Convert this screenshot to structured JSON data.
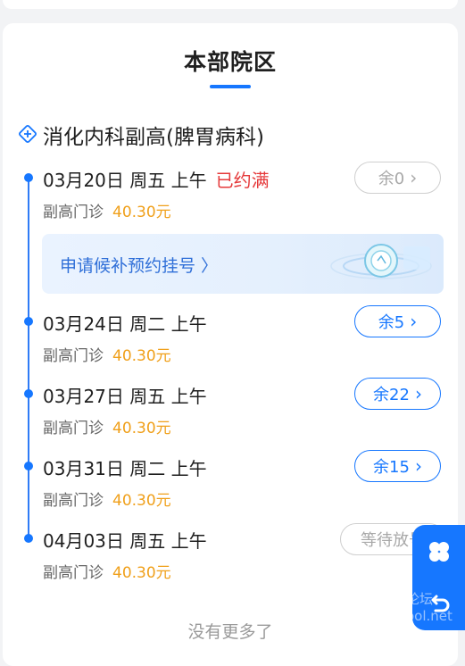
{
  "campus": {
    "title": "本部院区"
  },
  "department": {
    "name": "消化内科副高(脾胃病科)",
    "icon": "plus-diamond-icon"
  },
  "slots": [
    {
      "date": "03月20日",
      "weekday": "周五",
      "period": "上午",
      "status": "已约满",
      "type": "副高门诊",
      "price": "40.30元",
      "button": "余0",
      "available": false
    },
    {
      "date": "03月24日",
      "weekday": "周二",
      "period": "上午",
      "status": "",
      "type": "副高门诊",
      "price": "40.30元",
      "button": "余5",
      "available": true
    },
    {
      "date": "03月27日",
      "weekday": "周五",
      "period": "上午",
      "status": "",
      "type": "副高门诊",
      "price": "40.30元",
      "button": "余22",
      "available": true
    },
    {
      "date": "03月31日",
      "weekday": "周二",
      "period": "上午",
      "status": "",
      "type": "副高门诊",
      "price": "40.30元",
      "button": "余15",
      "available": true
    },
    {
      "date": "04月03日",
      "weekday": "周五",
      "period": "上午",
      "status": "",
      "type": "副高门诊",
      "price": "40.30元",
      "button": "等待放号",
      "available": false
    }
  ],
  "waitlist": {
    "label": "申请候补预约挂号 〉"
  },
  "footer": {
    "end_text": "没有更多了"
  },
  "float_panel": {
    "top_icon": "clover-icon",
    "bottom_icon": "return-icon"
  },
  "colors": {
    "accent": "#1677ff",
    "full": "#e5393a",
    "price": "#f0a01b"
  },
  "watermark": "论坛 ool.net"
}
